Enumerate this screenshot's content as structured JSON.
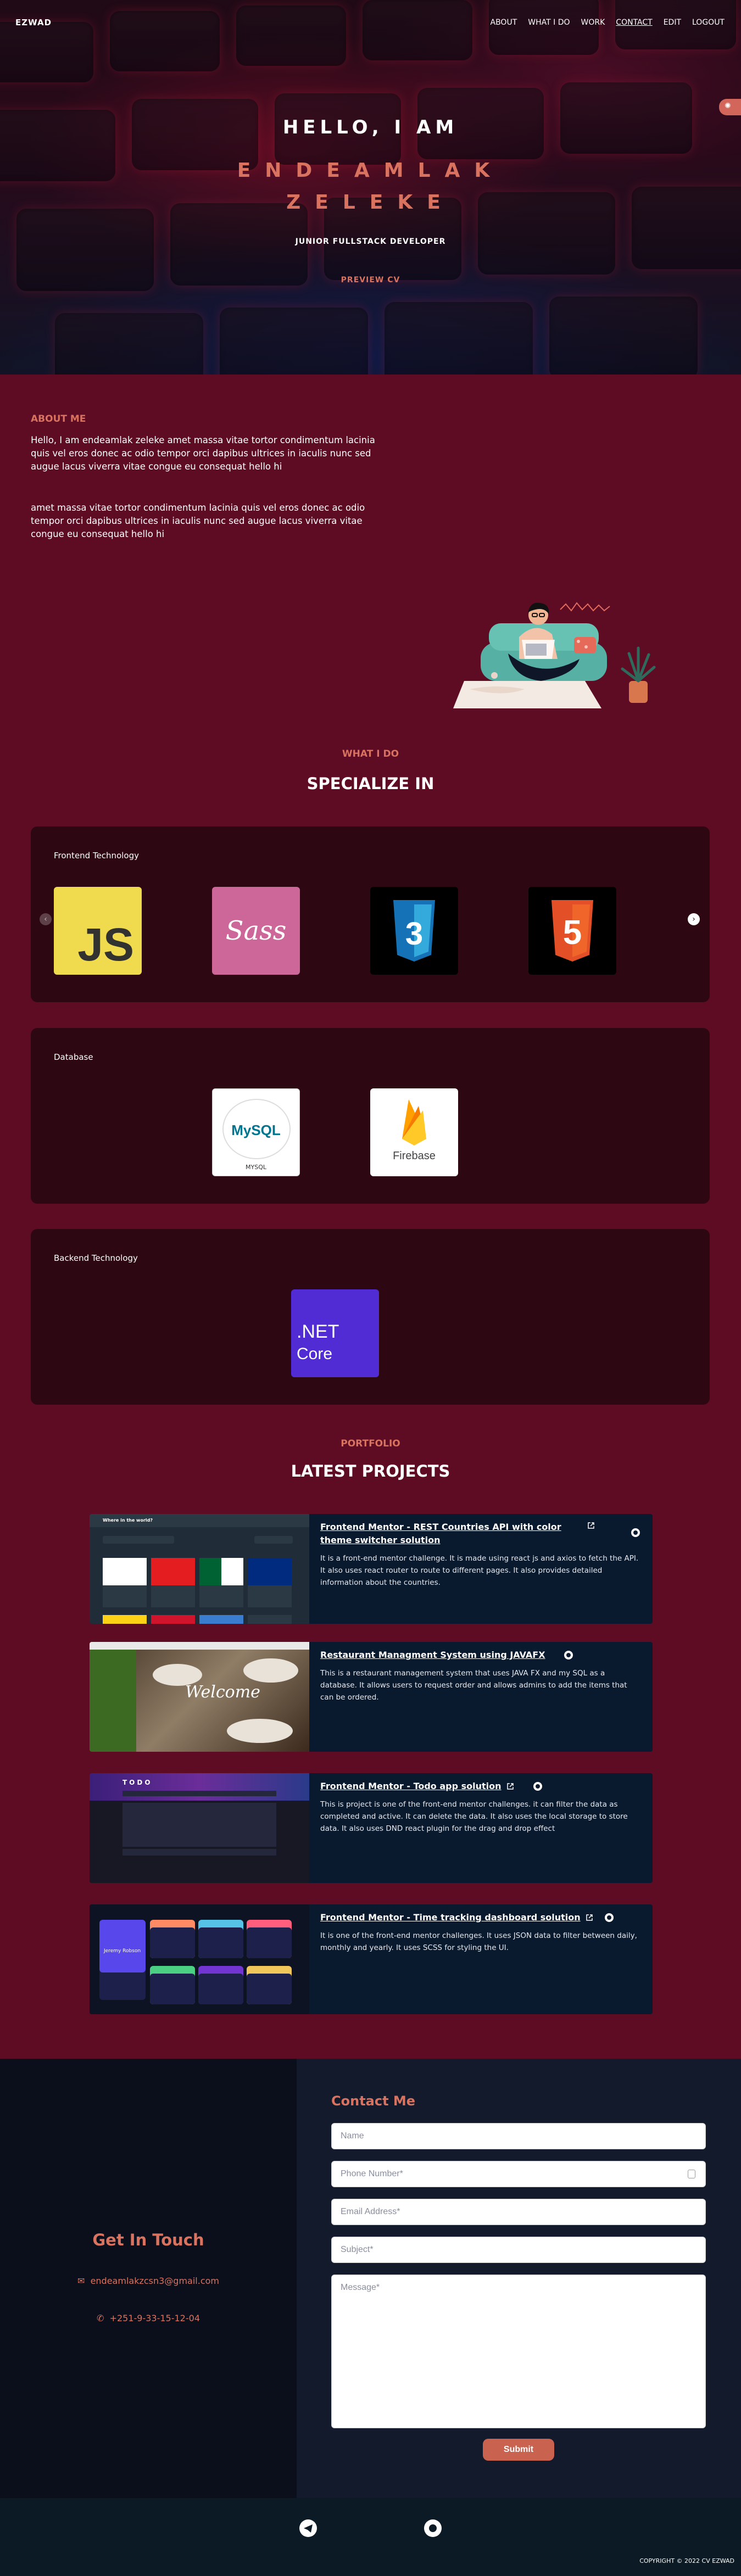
{
  "nav": {
    "brand": "EZWAD",
    "items": [
      "ABOUT",
      "WHAT I DO",
      "WORK",
      "CONTACT",
      "EDIT",
      "LOGOUT"
    ],
    "active": "CONTACT"
  },
  "hero": {
    "greeting": "HELLO, I AM",
    "first_name": "ENDEAMLAK",
    "last_name": "ZELEKE",
    "role": "JUNIOR FULLSTACK DEVELOPER",
    "cta": "PREVIEW CV"
  },
  "about": {
    "title": "ABOUT ME",
    "p1": "Hello, I am endeamlak zeleke amet massa vitae tortor condimentum lacinia quis vel eros donec ac odio tempor orci dapibus ultrices in iaculis nunc sed augue lacus viverra vitae congue eu consequat hello hi",
    "p2": "amet massa vitae tortor condimentum lacinia quis vel eros donec ac odio tempor orci dapibus ultrices in iaculis nunc sed augue lacus viverra vitae congue eu consequat hello hi"
  },
  "skills": {
    "subtitle": "WHAT I DO",
    "title": "SPECIALIZE IN",
    "groups": [
      {
        "name": "Frontend Technology",
        "items": [
          "JS",
          "Sass",
          "CSS3",
          "HTML5"
        ]
      },
      {
        "name": "Database",
        "items": [
          "MySQL",
          "Firebase"
        ]
      },
      {
        "name": "Backend Technology",
        "items": [
          ".NET Core"
        ]
      }
    ],
    "tile_text": {
      "js": "JS",
      "sass": "Sass",
      "css": "3",
      "html": "5",
      "mysql": "MySQL",
      "mysql_caption": "MYSQL",
      "firebase": "Firebase",
      "net": ".NET",
      "core": "Core"
    }
  },
  "projects": {
    "subtitle": "PORTFOLIO",
    "title": "LATEST PROJECTS",
    "items": [
      {
        "title": "Frontend Mentor - REST Countries API with color theme switcher solution",
        "desc": "It is a front-end mentor challenge. It is made using react js and axios to fetch the API. It also uses react router to route to different pages. It also provides detailed information about the countries.",
        "thumb_text": "Where in the world?"
      },
      {
        "title": "Restaurant Managment System using JAVAFX",
        "desc": "This is a restaurant management system that uses JAVA FX and my SQL as a database. It allows users to request order and allows admins to add the items that can be ordered.",
        "thumb_text": "Welcome"
      },
      {
        "title": "Frontend Mentor - Todo app solution",
        "desc": "This is project is one of the front-end mentor challenges. it can filter the data as completed and active. It can delete the data. It also uses the local storage to store data. It also uses DND react plugin for the drag and drop effect",
        "thumb_text": "TODO"
      },
      {
        "title": "Frontend Mentor - Time tracking dashboard solution",
        "desc": "It is one of the front-end mentor challenges. It uses JSON data to filter between daily, monthly and yearly. It uses SCSS for styling the UI.",
        "thumb_text": "Jeremy Robson"
      }
    ]
  },
  "contact": {
    "get_in_touch": "Get In Touch",
    "email": "endeamlakzcsn3@gmail.com",
    "phone": "+251-9-33-15-12-04",
    "form_title": "Contact Me",
    "placeholders": {
      "name": "Name",
      "phone": "Phone Number*",
      "email": "Email Address*",
      "subject": "Subject*",
      "message": "Message*"
    },
    "submit": "Submit"
  },
  "footer": {
    "copyright": "COPYRIGHT © 2022 CV EZWAD",
    "icons": [
      "telegram-icon",
      "github-icon"
    ]
  },
  "colors": {
    "accent": "#d9735f",
    "page_bg": "#5e0c24",
    "card_bg": "#2d0711",
    "project_bg": "#0a1a2e"
  }
}
